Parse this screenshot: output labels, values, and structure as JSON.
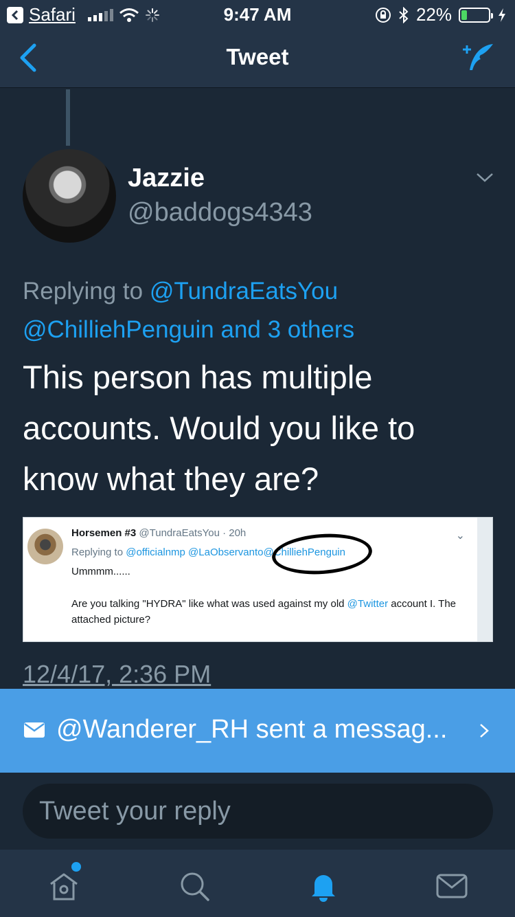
{
  "status_bar": {
    "back_app": "Safari",
    "time": "9:47 AM",
    "battery_pct": "22%",
    "battery_level": 0.22,
    "icons": [
      "signal-icon",
      "wifi-icon",
      "loading-icon",
      "orientation-lock-icon",
      "bluetooth-icon",
      "battery-icon",
      "charging-icon"
    ]
  },
  "nav": {
    "title": "Tweet",
    "back_icon": "chevron-left-icon",
    "compose_icon": "compose-tweet-icon"
  },
  "tweet": {
    "author_name": "Jazzie",
    "author_handle": "@baddogs4343",
    "replying_prefix": "Replying to",
    "replying_mention1": "@TundraEatsYou",
    "replying_mention2": "@ChilliehPenguin",
    "replying_suffix": "and 3 others",
    "text": "This person has multiple accounts.  Would you like to know what they are?",
    "timestamp": "12/4/17, 2:36 PM"
  },
  "embed": {
    "name": "Horsemen #3",
    "meta": "@TundraEatsYou · 20h",
    "reply_prefix": "Replying to",
    "reply_mentions": "@officialnmp @LaObservanto",
    "reply_circled": "@ChilliehPenguin",
    "line1": "Ummmm......",
    "body_before": "Are you talking \"HYDRA\" like what was used against my old ",
    "body_link": "@Twitter",
    "body_after": " account I. The attached picture?"
  },
  "message_banner": {
    "text": "@Wanderer_RH sent a messag...",
    "icon": "envelope-icon"
  },
  "reply": {
    "placeholder": "Tweet your reply"
  },
  "tabs": [
    {
      "name": "home",
      "icon": "home-icon"
    },
    {
      "name": "search",
      "icon": "search-icon"
    },
    {
      "name": "notifications",
      "icon": "bell-icon"
    },
    {
      "name": "messages",
      "icon": "envelope-icon"
    }
  ],
  "colors": {
    "background": "#1b2836",
    "bar": "#243447",
    "link": "#1da1f2",
    "banner": "#4a9ee6",
    "muted": "#8899a6"
  }
}
